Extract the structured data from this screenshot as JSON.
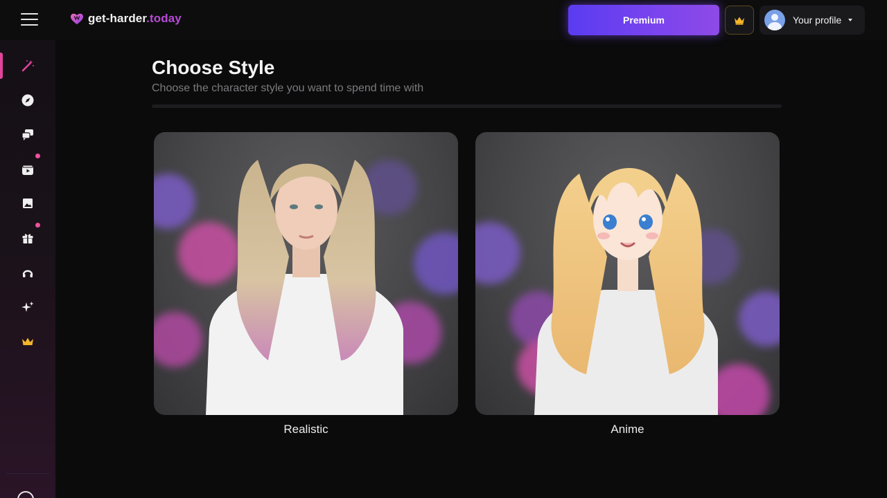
{
  "brand": {
    "name_part1": "get-harder",
    "name_part2": ".today",
    "accent": "#b84bd6"
  },
  "header": {
    "premium_label": "Premium",
    "crown_icon": "crown-icon",
    "profile_label": "Your profile"
  },
  "sidebar": {
    "items": [
      {
        "icon": "magic-wand-icon",
        "active": true
      },
      {
        "icon": "compass-icon"
      },
      {
        "icon": "chat-bubbles-icon"
      },
      {
        "icon": "video-clapper-icon",
        "badge": true
      },
      {
        "icon": "image-icon"
      },
      {
        "icon": "gift-box-icon",
        "badge": true
      },
      {
        "icon": "headphones-icon"
      },
      {
        "icon": "sparkles-icon"
      },
      {
        "icon": "crown-icon",
        "color": "#f3b52a"
      }
    ],
    "active_color": "#e2449b"
  },
  "main": {
    "title": "Choose Style",
    "subtitle": "Choose the character style you want to spend time with",
    "styles": [
      {
        "label": "Realistic"
      },
      {
        "label": "Anime"
      }
    ]
  }
}
